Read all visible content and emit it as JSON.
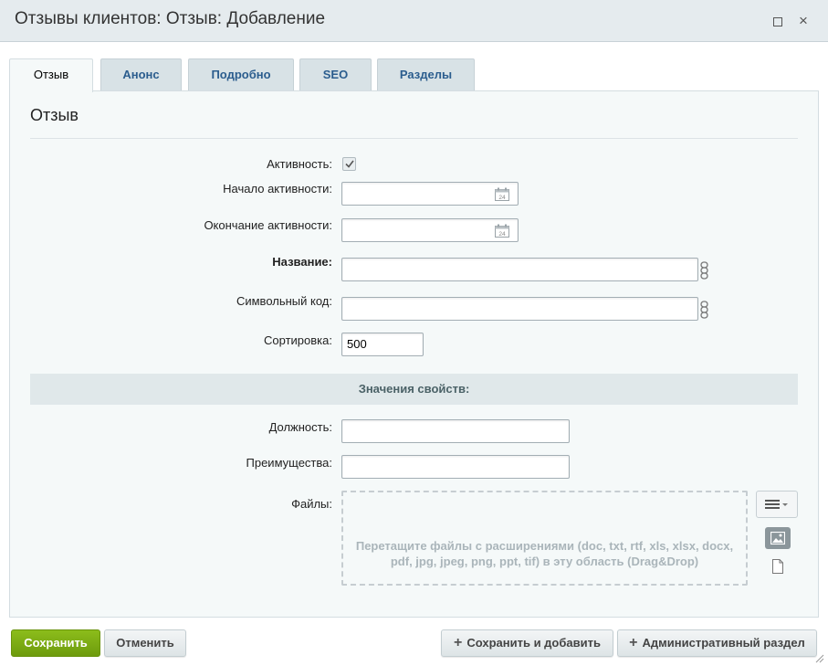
{
  "window": {
    "title": "Отзывы клиентов: Отзыв: Добавление",
    "maximize_icon": "maximize-icon",
    "close_glyph": "×"
  },
  "tabs": [
    {
      "label": "Отзыв",
      "active": true
    },
    {
      "label": "Анонс",
      "active": false
    },
    {
      "label": "Подробно",
      "active": false
    },
    {
      "label": "SEO",
      "active": false
    },
    {
      "label": "Разделы",
      "active": false
    }
  ],
  "form": {
    "section_title": "Отзыв",
    "active_label": "Активность:",
    "active_checked": true,
    "active_from_label": "Начало активности:",
    "active_from_value": "",
    "active_to_label": "Окончание активности:",
    "active_to_value": "",
    "name_label": "Название:",
    "name_value": "",
    "code_label": "Символьный код:",
    "code_value": "",
    "sort_label": "Сортировка:",
    "sort_value": "500",
    "calendar_icon_day": "24",
    "props_header": "Значения свойств:",
    "position_label": "Должность:",
    "position_value": "",
    "advantages_label": "Преимущества:",
    "advantages_value": "",
    "files_label": "Файлы:",
    "dropzone_text": "Перетащите файлы с расширениями (doc, txt, rtf, xls, xlsx, docx, pdf, jpg, jpeg, png, ppt, tif) в эту область (Drag&Drop)"
  },
  "buttons": {
    "save": "Сохранить",
    "cancel": "Отменить",
    "save_and_add": "Сохранить и добавить",
    "admin_section": "Административный раздел",
    "plus_glyph": "+"
  },
  "colors": {
    "save_green": "#7aa912",
    "tab_link": "#2b5d8e",
    "panel_bg": "#f5f9f9"
  }
}
